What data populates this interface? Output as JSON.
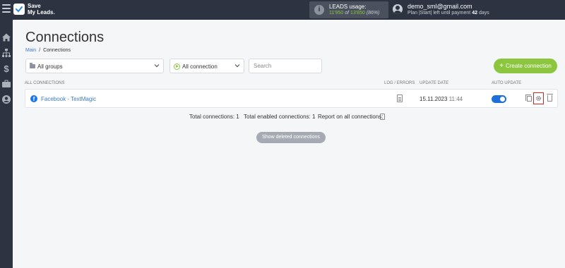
{
  "brand": {
    "line1": "Save",
    "line2": "My Leads."
  },
  "leads_usage": {
    "label": "LEADS usage:",
    "used": "11'950",
    "of": "of",
    "total": "13'850",
    "percent": "(86%)"
  },
  "user": {
    "email": "demo_sml@gmail.com",
    "plan_prefix": "Plan |Start| left until payment",
    "days_value": "42",
    "days_unit": "days"
  },
  "sidebar": {
    "items": [
      "home-icon",
      "sitemap-icon",
      "dollar-icon",
      "briefcase-icon",
      "user-circle-icon"
    ]
  },
  "page": {
    "title": "Connections",
    "breadcrumb": {
      "main": "Main",
      "separator": "/",
      "current": "Connections"
    }
  },
  "filters": {
    "groups": "All groups",
    "connection": "All connection",
    "search_placeholder": "Search"
  },
  "create_button": {
    "plus": "+",
    "label": "Create connection"
  },
  "columns": {
    "all": "ALL CONNECTIONS",
    "log": "LOG / ERRORS",
    "update_date": "UPDATE DATE",
    "auto_update": "AUTO UPDATE"
  },
  "connections": [
    {
      "icon": "facebook-icon",
      "name": "Facebook - TextMagic",
      "date": "15.11.2023",
      "time": "11:44",
      "auto_update": true
    }
  ],
  "totals": {
    "total": "Total connections: 1",
    "enabled": "Total enabled connections: 1",
    "report": "Report on all connections:"
  },
  "show_deleted": "Show deleted connections",
  "colors": {
    "topbar": "#2d3340",
    "accent_green": "#8cc63f",
    "link_blue": "#3a7ac9",
    "toggle_blue": "#1e6fd9",
    "highlight_red": "#e0201f"
  }
}
